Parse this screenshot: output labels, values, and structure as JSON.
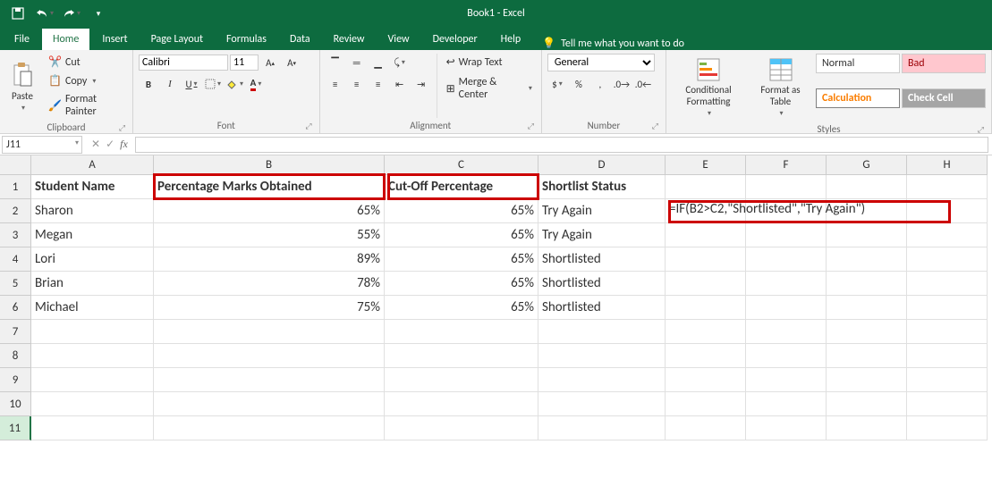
{
  "title": "Book1 - Excel",
  "qat": [
    "save",
    "undo",
    "redo"
  ],
  "tabs": [
    "File",
    "Home",
    "Insert",
    "Page Layout",
    "Formulas",
    "Data",
    "Review",
    "View",
    "Developer",
    "Help"
  ],
  "active_tab": "Home",
  "tellme": "Tell me what you want to do",
  "clipboard": {
    "paste": "Paste",
    "cut": "Cut",
    "copy": "Copy",
    "fp": "Format Painter",
    "label": "Clipboard"
  },
  "font": {
    "name": "Calibri",
    "size": "11",
    "label": "Font"
  },
  "alignment": {
    "wrap": "Wrap Text",
    "merge": "Merge & Center",
    "label": "Alignment"
  },
  "number": {
    "format": "General",
    "label": "Number"
  },
  "styles": {
    "cf": "Conditional Formatting",
    "fat": "Format as Table",
    "normal": "Normal",
    "bad": "Bad",
    "calc": "Calculation",
    "check": "Check Cell",
    "label": "Styles"
  },
  "namebox": "J11",
  "columns": [
    "A",
    "B",
    "C",
    "D",
    "E",
    "F",
    "G",
    "H"
  ],
  "headers": {
    "A": "Student Name",
    "B": "Percentage Marks Obtained",
    "C": "Cut-Off Percentage",
    "D": "Shortlist Status"
  },
  "rows": [
    {
      "A": "Sharon",
      "B": "65%",
      "C": "65%",
      "D": "Try Again"
    },
    {
      "A": "Megan",
      "B": "55%",
      "C": "65%",
      "D": "Try Again"
    },
    {
      "A": "Lori",
      "B": "89%",
      "C": "65%",
      "D": "Shortlisted"
    },
    {
      "A": "Brian",
      "B": "78%",
      "C": "65%",
      "D": "Shortlisted"
    },
    {
      "A": "Michael",
      "B": "75%",
      "C": "65%",
      "D": "Shortlisted"
    }
  ],
  "formula_display": "=IF(B2>C2,\"Shortlisted\",\"Try Again\")"
}
